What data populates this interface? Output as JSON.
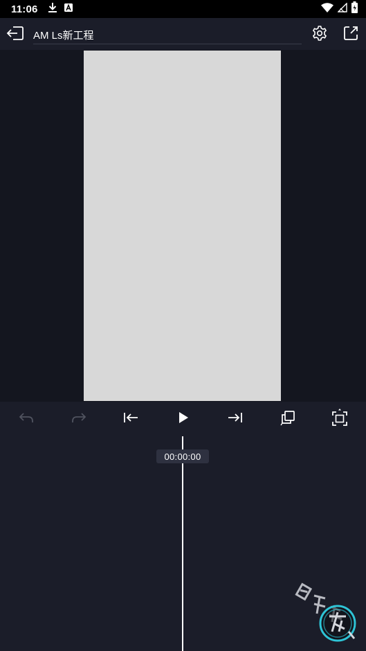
{
  "status_bar": {
    "time": "11:06",
    "icons": [
      "download-icon",
      "a-badge-icon",
      "wifi-icon",
      "signal-icon",
      "battery-icon"
    ]
  },
  "header": {
    "project_title": "AM Ls新工程",
    "icons": [
      "exit-icon",
      "settings-icon",
      "share-icon"
    ]
  },
  "toolbar": {
    "buttons": [
      "undo",
      "redo",
      "jump-to-start",
      "play",
      "jump-to-end",
      "copy",
      "fullscreen"
    ]
  },
  "timeline": {
    "timecode": "00:00:00"
  },
  "colors": {
    "background": "#14161f",
    "panel": "#1b1d29",
    "canvas": "#d8d8d8",
    "accent": "#2ec4d6"
  }
}
